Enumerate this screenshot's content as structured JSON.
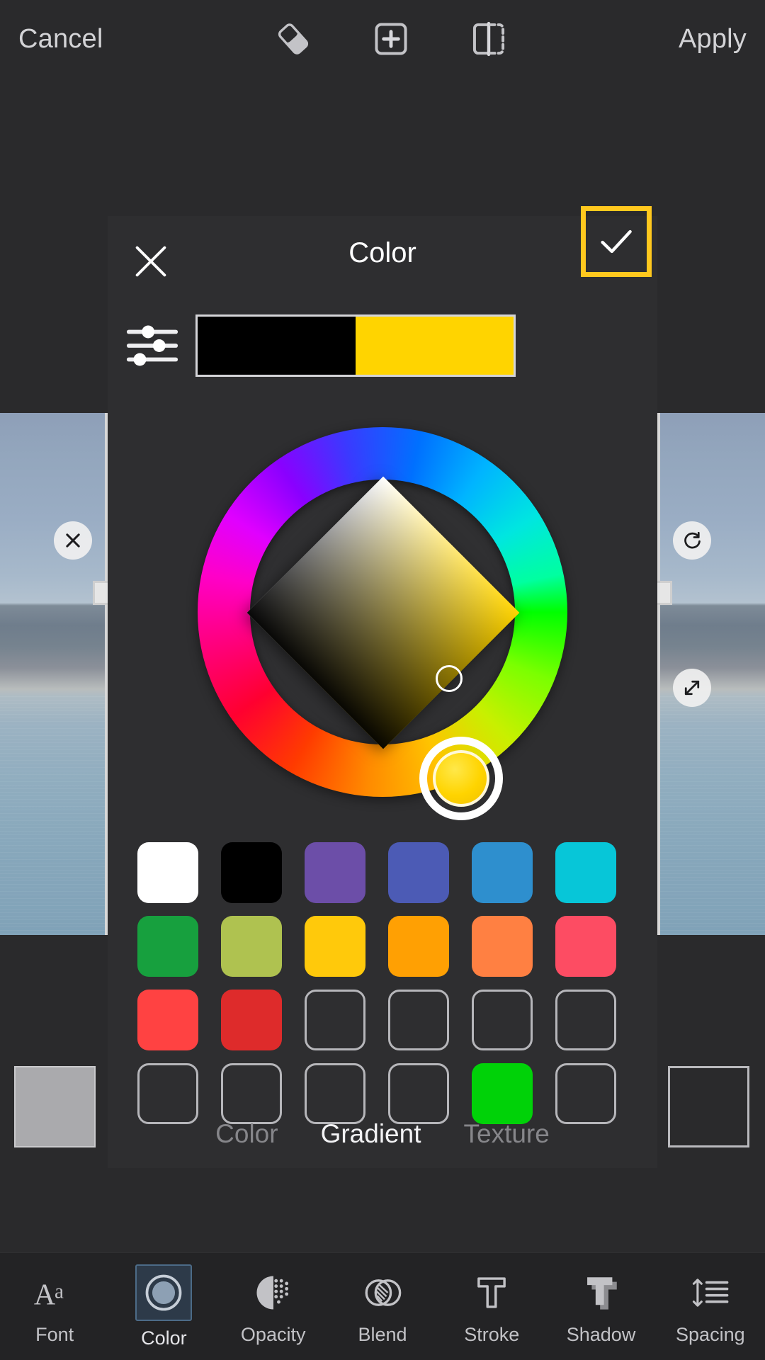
{
  "topbar": {
    "cancel_label": "Cancel",
    "apply_label": "Apply",
    "icons": [
      {
        "name": "eraser-icon",
        "label": "Eraser"
      },
      {
        "name": "add-box-icon",
        "label": "Add"
      },
      {
        "name": "mirror-flip-icon",
        "label": "Mirror"
      }
    ]
  },
  "color_panel": {
    "title": "Color",
    "close_icon": "close-icon",
    "confirm_icon": "checkmark-icon",
    "confirm_highlight_color": "#FFC81E",
    "gradient_settings_icon": "sliders-icon",
    "gradient_preview": {
      "stop_a": "#000000",
      "stop_b": "#FFD400"
    },
    "wheel": {
      "selected_hue_color": "#FFD400",
      "diamond_tip_color": "#FFD400",
      "sb_cursor_label": "saturation-brightness-cursor",
      "hue_cursor_label": "hue-cursor"
    },
    "swatches": [
      {
        "color": "#FFFFFF",
        "empty": false
      },
      {
        "color": "#000000",
        "empty": false
      },
      {
        "color": "#6C4EA8",
        "empty": false
      },
      {
        "color": "#4C5BB5",
        "empty": false
      },
      {
        "color": "#2E8FCE",
        "empty": false
      },
      {
        "color": "#07C6D8",
        "empty": false
      },
      {
        "color": "#17A03E",
        "empty": false
      },
      {
        "color": "#AFC250",
        "empty": false
      },
      {
        "color": "#FFC90B",
        "empty": false
      },
      {
        "color": "#FFA003",
        "empty": false
      },
      {
        "color": "#FF8042",
        "empty": false
      },
      {
        "color": "#FD4C63",
        "empty": false
      },
      {
        "color": "#FF4242",
        "empty": false
      },
      {
        "color": "#DE2B2B",
        "empty": false
      },
      {
        "color": "",
        "empty": true
      },
      {
        "color": "",
        "empty": true
      },
      {
        "color": "",
        "empty": true
      },
      {
        "color": "",
        "empty": true
      },
      {
        "color": "",
        "empty": true
      },
      {
        "color": "",
        "empty": true
      },
      {
        "color": "",
        "empty": true
      },
      {
        "color": "",
        "empty": true
      },
      {
        "color": "#00D208",
        "empty": false
      },
      {
        "color": "",
        "empty": true
      }
    ],
    "mode_tabs": [
      {
        "label": "Color",
        "active": false
      },
      {
        "label": "Gradient",
        "active": true
      },
      {
        "label": "Texture",
        "active": false
      }
    ]
  },
  "canvas": {
    "delete_handle_icon": "close-icon",
    "rotate_handle_icon": "rotate-icon",
    "resize_handle_icon": "resize-diagonal-icon"
  },
  "bottom_toolbar": [
    {
      "label": "Font",
      "icon": "font-aa-icon",
      "active": false
    },
    {
      "label": "Color",
      "icon": "color-circle-icon",
      "active": true
    },
    {
      "label": "Opacity",
      "icon": "opacity-halftone-icon",
      "active": false
    },
    {
      "label": "Blend",
      "icon": "blend-circles-icon",
      "active": false
    },
    {
      "label": "Stroke",
      "icon": "stroke-t-icon",
      "active": false
    },
    {
      "label": "Shadow",
      "icon": "shadow-t-icon",
      "active": false
    },
    {
      "label": "Spacing",
      "icon": "line-spacing-icon",
      "active": false
    }
  ]
}
